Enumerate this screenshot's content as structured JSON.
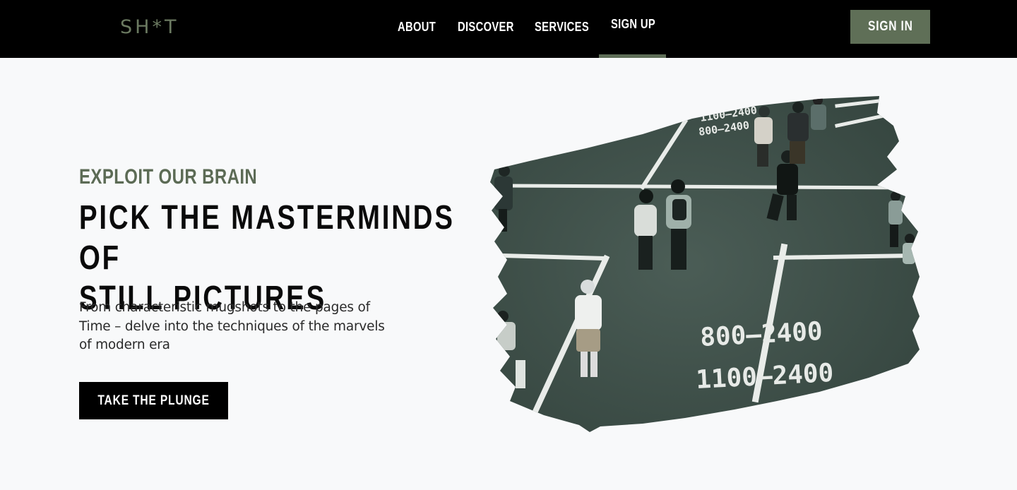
{
  "header": {
    "logo": "SH*T",
    "nav": [
      {
        "label": "ABOUT"
      },
      {
        "label": "DISCOVER"
      },
      {
        "label": "SERVICES"
      },
      {
        "label": "SIGN UP"
      }
    ],
    "signin_label": "SIGN IN"
  },
  "hero": {
    "eyebrow": "EXPLOIT OUR BRAIN",
    "title_line1": "PICK THE MASTERMINDS OF",
    "title_line2": "STILL PICTURES",
    "description_line1": "From characteristic mugshots to the pages of",
    "description_line2": "Time – delve into the techniques of the marvels",
    "description_line3": "of modern era",
    "cta_label": "TAKE THE PLUNGE",
    "image": {
      "road_markings": [
        "800–2400",
        "1100–2400"
      ]
    }
  },
  "colors": {
    "nav_bg": "#000000",
    "accent": "#5f6f57",
    "page_bg": "#f8f9fa",
    "asphalt": "#3e4f49"
  }
}
